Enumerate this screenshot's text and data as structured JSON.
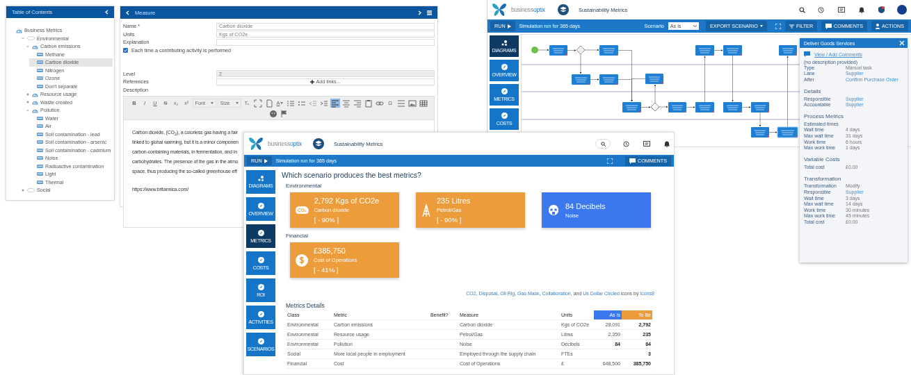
{
  "toc": {
    "title": "Table of Contents",
    "tree": [
      {
        "label": "Business Metrics",
        "kind": "root",
        "selected": false,
        "children": [
          {
            "label": "Environmental",
            "kind": "category",
            "expanded": true,
            "selected": false,
            "children": [
              {
                "label": "Carbon emissions",
                "kind": "group",
                "expanded": true,
                "selected": false,
                "children": [
                  {
                    "label": "Methane",
                    "kind": "measure",
                    "selected": false
                  },
                  {
                    "label": "Carbon dioxide",
                    "kind": "measure",
                    "selected": true
                  },
                  {
                    "label": "Nitrogen",
                    "kind": "measure",
                    "selected": false
                  },
                  {
                    "label": "Ozone",
                    "kind": "measure",
                    "selected": false
                  },
                  {
                    "label": "Don't separate",
                    "kind": "measure",
                    "selected": false
                  }
                ]
              },
              {
                "label": "Resource usage",
                "kind": "group",
                "expanded": false,
                "selected": false
              },
              {
                "label": "Waste created",
                "kind": "group",
                "expanded": false,
                "selected": false
              },
              {
                "label": "Pollution",
                "kind": "group",
                "expanded": true,
                "selected": false,
                "children": [
                  {
                    "label": "Water",
                    "kind": "measure",
                    "selected": false
                  },
                  {
                    "label": "Air",
                    "kind": "measure",
                    "selected": false
                  },
                  {
                    "label": "Soil contamination - lead",
                    "kind": "measure",
                    "selected": false
                  },
                  {
                    "label": "Soil contamination - arsenic",
                    "kind": "measure",
                    "selected": false
                  },
                  {
                    "label": "Soil contamination - cadmium",
                    "kind": "measure",
                    "selected": false
                  },
                  {
                    "label": "Noise",
                    "kind": "measure",
                    "selected": false
                  },
                  {
                    "label": "Radioactive contamination",
                    "kind": "measure",
                    "selected": false
                  },
                  {
                    "label": "Light",
                    "kind": "measure",
                    "selected": false
                  },
                  {
                    "label": "Thermal",
                    "kind": "measure",
                    "selected": false
                  }
                ]
              }
            ]
          },
          {
            "label": "Social",
            "kind": "category",
            "expanded": false,
            "selected": false
          }
        ]
      }
    ]
  },
  "editor": {
    "title": "Measure",
    "fields": [
      {
        "label": "Name *",
        "value": "Carbon dioxide"
      },
      {
        "label": "Units",
        "value": "Kgs of CO2e"
      },
      {
        "label": "Explanation"
      }
    ],
    "checkbox": {
      "label": "Each time a contributing activity is performed",
      "checked": true
    },
    "level": {
      "label": "Level",
      "value": "2"
    },
    "references": {
      "label": "References",
      "button": "Add links..."
    },
    "description": {
      "label": "Description",
      "toolbar": [
        {
          "kind": "bold",
          "text": "B",
          "selected": false
        },
        {
          "kind": "italic",
          "text": "I",
          "selected": false
        },
        {
          "kind": "underline",
          "text": "U",
          "selected": false
        },
        {
          "kind": "strike",
          "text": "S",
          "selected": false
        },
        {
          "kind": "subscript",
          "text": "x₂",
          "selected": false
        },
        {
          "kind": "superscript",
          "text": "x²",
          "selected": false
        },
        {
          "kind": "font",
          "text": "Font",
          "selected": false
        },
        {
          "kind": "size",
          "text": "Size",
          "selected": false
        },
        {
          "kind": "clear-format",
          "text": "Tₓ",
          "selected": false
        },
        {
          "kind": "maximize",
          "selected": false
        },
        {
          "kind": "source",
          "selected": false
        },
        {
          "kind": "text-color",
          "text": "A",
          "selected": false
        },
        {
          "kind": "numbered-list",
          "selected": false
        },
        {
          "kind": "bullet-list",
          "selected": false
        },
        {
          "kind": "outdent",
          "selected": false
        },
        {
          "kind": "indent",
          "selected": false
        },
        {
          "kind": "align-left",
          "selected": true
        },
        {
          "kind": "align-center",
          "selected": false
        },
        {
          "kind": "align-right",
          "selected": false
        },
        {
          "kind": "paste",
          "selected": false
        },
        {
          "kind": "link",
          "selected": false
        },
        {
          "kind": "special-char",
          "text": "Ω",
          "selected": false
        },
        {
          "kind": "horizontal-line",
          "selected": false
        },
        {
          "kind": "image",
          "selected": false
        },
        {
          "kind": "table",
          "selected": false
        },
        {
          "kind": "smiley",
          "selected": false
        },
        {
          "kind": "flag",
          "selected": false
        }
      ],
      "lines": [
        "Carbon dioxide, (CO$_{2}$), a colorless gas having a fair",
        "linked to global warming, but it is a minor componen",
        "carbon-containing materials, in fermentation, and in",
        "carbohydrates. The presence of the gas in the atmo",
        "space, thus producing the so-called greenhouse eff"
      ],
      "url": "https://www.britannica.com/"
    }
  },
  "back_window": {
    "brand_parts": [
      "business",
      "optix"
    ],
    "title": "Sustainability Metrics",
    "toolbar": {
      "run": "RUN",
      "status": "Simulation run for 365 days",
      "scenario_label": "Scenario",
      "scenario_value": "As is",
      "export": "EXPORT SCENARIO",
      "filter": "FILTER",
      "comments": "COMMENTS",
      "actions": "ACTIONS"
    },
    "nav": [
      {
        "label": "DIAGRAMS",
        "kind": "diagrams",
        "selected": true
      },
      {
        "label": "OVERVIEW",
        "kind": "page",
        "selected": false
      },
      {
        "label": "METRICS",
        "kind": "page",
        "selected": false
      },
      {
        "label": "COSTS",
        "kind": "page",
        "selected": false
      }
    ]
  },
  "side_panel": {
    "title": "Deliver Goods Services",
    "comments_link": "View / Add Comments",
    "description": "(no description provided)",
    "sections": [
      {
        "rows": [
          {
            "label": "Type",
            "value": "Manual task",
            "link": false
          },
          {
            "label": "Lane",
            "value": "Supplier",
            "link": true
          },
          {
            "label": "After",
            "value": "Confirm Purchase Order",
            "link": true
          }
        ]
      },
      {
        "heading": "Details",
        "rows": [
          {
            "label": "Responsible",
            "value": "Supplier",
            "link": true
          },
          {
            "label": "Accountable",
            "value": "Supplier",
            "link": true
          }
        ]
      },
      {
        "heading": "Process Metrics",
        "rows": [
          {
            "label": "Estimated times"
          },
          {
            "label": "Wait time",
            "value": "4 days",
            "link": false
          },
          {
            "label": "Max wait time",
            "value": "31 days",
            "link": false
          },
          {
            "label": "Work time",
            "value": "6 hours",
            "link": false
          },
          {
            "label": "Max work time",
            "value": "1 days",
            "link": false
          }
        ]
      },
      {
        "heading": "Variable Costs",
        "rows": [
          {
            "label": "Total cost",
            "value": "£0.00",
            "link": false
          }
        ]
      },
      {
        "heading": "Transformation",
        "rows": [
          {
            "label": "Transformation",
            "value": "Modify",
            "link": false
          },
          {
            "label": "Responsible",
            "value": "Supplier",
            "link": true
          },
          {
            "label": "Wait time",
            "value": "3 days",
            "link": false
          },
          {
            "label": "Max wait time",
            "value": "14 days",
            "link": false
          },
          {
            "label": "Work time",
            "value": "30 minutes",
            "link": false
          },
          {
            "label": "Max work time",
            "value": "45 minutes",
            "link": false
          },
          {
            "label": "Total cost",
            "value": "£0.00",
            "link": false
          }
        ]
      }
    ]
  },
  "front_window": {
    "brand_parts": [
      "business",
      "optix"
    ],
    "title": "Sustainability Metrics",
    "toolbar": {
      "run": "RUN",
      "status": "Simulation run for 365 days",
      "comments": "COMMENTS"
    },
    "nav": [
      {
        "label": "DIAGRAMS",
        "kind": "diagrams",
        "selected": false
      },
      {
        "label": "OVERVIEW",
        "kind": "page",
        "selected": false
      },
      {
        "label": "METRICS",
        "kind": "page",
        "selected": true
      },
      {
        "label": "COSTS",
        "kind": "page",
        "selected": false
      },
      {
        "label": "ROI",
        "kind": "page",
        "selected": false
      },
      {
        "label": "ACTIVITIES",
        "kind": "page",
        "selected": false
      },
      {
        "label": "SCENARIOS",
        "kind": "page",
        "selected": false
      }
    ],
    "question": "Which scenario produces the best metrics?",
    "groups": [
      {
        "heading": "Environmental",
        "cards": [
          {
            "kind": "co2",
            "icon_text": "CO₂",
            "value": "2,792 Kgs of CO2e",
            "label": "Carbon dioxide",
            "change": "[ - 90% ]",
            "color": "#ec9c3a"
          },
          {
            "kind": "oil-rig",
            "value": "235 Litres",
            "label": "Petrol/Gas",
            "change": "[ - 90% ]",
            "color": "#ec9c3a"
          },
          {
            "kind": "gas-mask",
            "value": "84 Decibels",
            "label": "Noise",
            "color": "#3b78ee"
          }
        ]
      },
      {
        "heading": "Financial",
        "cards": [
          {
            "kind": "dollar",
            "value": "£385,750",
            "label": "Cost of Operations",
            "change": "[ - 41% ]",
            "color": "#ec9c3a"
          }
        ]
      }
    ],
    "attribution": [
      {
        "text": "CO2",
        "kind": "link"
      },
      {
        "text": ", ",
        "kind": "text"
      },
      {
        "text": "Disposal",
        "kind": "link"
      },
      {
        "text": ", ",
        "kind": "text"
      },
      {
        "text": "Oil Rig",
        "kind": "link"
      },
      {
        "text": ", ",
        "kind": "text"
      },
      {
        "text": "Gas Mask",
        "kind": "link"
      },
      {
        "text": ", ",
        "kind": "text"
      },
      {
        "text": "Collaboration",
        "kind": "link"
      },
      {
        "text": ", and ",
        "kind": "text"
      },
      {
        "text": "Us Dollar Circled",
        "kind": "link"
      },
      {
        "text": " icons by ",
        "kind": "text"
      },
      {
        "text": "Icons8",
        "kind": "link"
      }
    ],
    "details": {
      "title": "Metrics Details",
      "columns": [
        "Class",
        "Metric",
        "Benefit?",
        "Measure",
        "Units",
        "As Is",
        "To Be"
      ],
      "rows": [
        {
          "class": "Environmental",
          "metric": "Carbon emissions",
          "measure": "Carbon dioxide",
          "units": "Kgs of CO2e",
          "as_is": "28,091",
          "as_is_bold": false,
          "to_be": "2,792"
        },
        {
          "class": "Environmental",
          "metric": "Resource usage",
          "measure": "Petrol/Gas",
          "units": "Litres",
          "as_is": "2,359",
          "as_is_bold": false,
          "to_be": "235"
        },
        {
          "class": "Environmental",
          "metric": "Pollution",
          "measure": "Noise",
          "units": "Decibels",
          "as_is": "84",
          "as_is_bold": true,
          "to_be": "84"
        },
        {
          "class": "Social",
          "metric": "More local people in employment",
          "measure": "Employed through the supply chain",
          "units": "FTEs",
          "to_be": "3"
        },
        {
          "class": "Financial",
          "metric": "Cost",
          "measure": "Cost of Operations",
          "units": "£",
          "as_is": "648,500",
          "as_is_bold": false,
          "to_be": "385,750"
        }
      ]
    }
  }
}
